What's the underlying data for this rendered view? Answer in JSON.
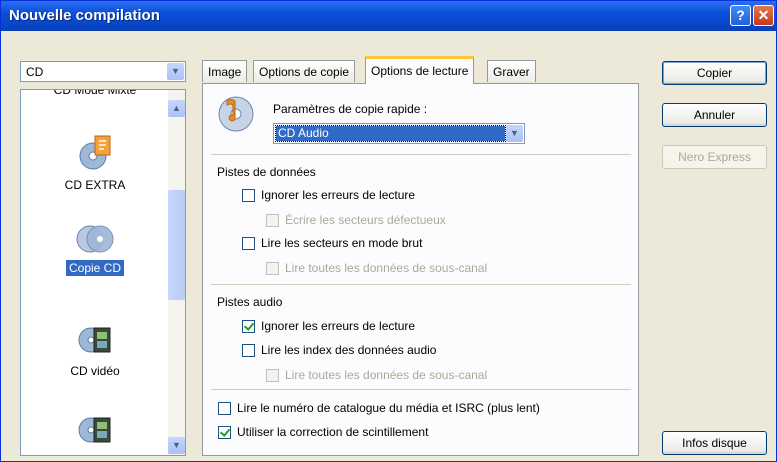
{
  "window": {
    "title": "Nouvelle compilation"
  },
  "compilation_type": {
    "value": "CD"
  },
  "compilation_list": [
    {
      "label": "CD Mode Mixte",
      "selected": false,
      "icon": "cd-mixed-icon"
    },
    {
      "label": "CD EXTRA",
      "selected": false,
      "icon": "cd-extra-icon"
    },
    {
      "label": "Copie CD",
      "selected": true,
      "icon": "cd-copy-icon"
    },
    {
      "label": "CD vidéo",
      "selected": false,
      "icon": "video-cd-icon"
    },
    {
      "label": "",
      "selected": false,
      "icon": "video-cd-icon"
    }
  ],
  "tabs": [
    "Image",
    "Options de copie",
    "Options de lecture",
    "Graver"
  ],
  "active_tab": "Options de lecture",
  "read_options": {
    "quick_copy_label": "Paramètres de copie rapide :",
    "quick_copy_value": "CD Audio",
    "data_tracks": {
      "heading": "Pistes de données",
      "ignore_read_errors": {
        "label": "Ignorer les erreurs de lecture",
        "checked": false
      },
      "write_bad_sectors": {
        "label": "Écrire les secteurs défectueux",
        "checked": false,
        "disabled": true
      },
      "read_raw": {
        "label": "Lire les secteurs en mode brut",
        "checked": false
      },
      "read_subchannel": {
        "label": "Lire toutes les données de sous-canal",
        "checked": false,
        "disabled": true
      }
    },
    "audio_tracks": {
      "heading": "Pistes audio",
      "ignore_read_errors": {
        "label": "Ignorer les erreurs de lecture",
        "checked": true
      },
      "read_audio_index": {
        "label": "Lire les index des données audio",
        "checked": false
      },
      "read_subchannel": {
        "label": "Lire toutes les données de sous-canal",
        "checked": false,
        "disabled": true
      }
    },
    "read_isrc": {
      "label": "Lire le numéro de catalogue du média et ISRC (plus lent)",
      "checked": false
    },
    "jitter_correction": {
      "label": "Utiliser la correction de scintillement",
      "checked": true
    }
  },
  "buttons": {
    "copy": "Copier",
    "cancel": "Annuler",
    "nero_express": "Nero Express",
    "disc_info": "Infos disque"
  },
  "colors": {
    "title_bar": "#0a4fd8",
    "selection": "#316ac5",
    "active_tab_accent": "#ffc83c",
    "checkmark": "#21a121"
  }
}
